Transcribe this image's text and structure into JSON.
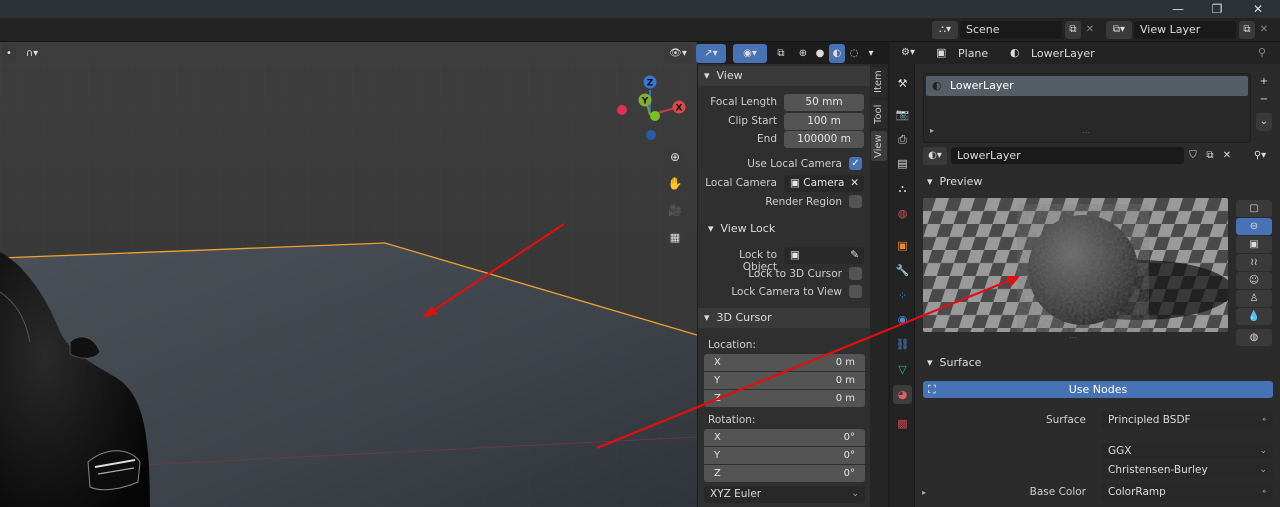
{
  "titlebar": {
    "minimize": "—",
    "restore": "❐",
    "close": "✕"
  },
  "topbar": {
    "scene_label": "Scene",
    "view_layer_label": "View Layer"
  },
  "viewport": {
    "header_left_icon": "editor-type-icon",
    "header_curve_icon": "falloff-curve-icon"
  },
  "npanel": {
    "tabs": [
      "Item",
      "Tool",
      "View"
    ],
    "view": {
      "title": "View",
      "focal_length_label": "Focal Length",
      "focal_length_value": "50 mm",
      "clip_start_label": "Clip Start",
      "clip_start_value": "100 m",
      "end_label": "End",
      "end_value": "100000 m",
      "use_local_camera_label": "Use Local Camera",
      "local_camera_label": "Local Camera",
      "local_camera_value": "Camera",
      "render_region_label": "Render Region"
    },
    "view_lock": {
      "title": "View Lock",
      "lock_to_object_label": "Lock to Object",
      "lock_to_cursor_label": "Lock to 3D Cursor",
      "lock_camera_label": "Lock Camera to View"
    },
    "cursor": {
      "title": "3D Cursor",
      "location_label": "Location:",
      "location": [
        {
          "k": "X",
          "v": "0 m"
        },
        {
          "k": "Y",
          "v": "0 m"
        },
        {
          "k": "Z",
          "v": "0 m"
        }
      ],
      "rotation_label": "Rotation:",
      "rotation": [
        {
          "k": "X",
          "v": "0°"
        },
        {
          "k": "Y",
          "v": "0°"
        },
        {
          "k": "Z",
          "v": "0°"
        }
      ],
      "rotation_mode": "XYZ Euler"
    }
  },
  "properties": {
    "breadcrumb_object": "Plane",
    "breadcrumb_material": "LowerLayer",
    "material_slot": "LowerLayer",
    "material_name": "LowerLayer",
    "preview_title": "Preview",
    "surface_title": "Surface",
    "use_nodes_label": "Use Nodes",
    "surface_label": "Surface",
    "surface_value": "Principled BSDF",
    "distribution_value": "GGX",
    "subsurface_value": "Christensen-Burley",
    "base_color_label": "Base Color",
    "base_color_value": "ColorRamp"
  },
  "colors": {
    "accent": "#4772b3",
    "selection_orange": "#f0a030",
    "annotation_red": "#e01010"
  }
}
